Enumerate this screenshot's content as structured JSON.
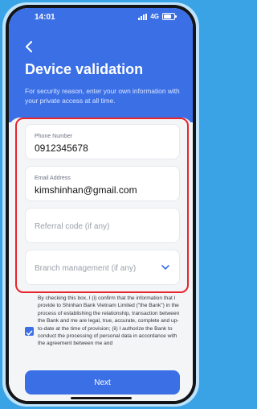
{
  "status": {
    "time": "14:01",
    "network": "4G"
  },
  "header": {
    "title": "Device validation",
    "subtitle": "For security reason, enter your own information with your private access at all time."
  },
  "form": {
    "phone_label": "Phone Number",
    "phone_value": "0912345678",
    "email_label": "Email Address",
    "email_value": "kimshinhan@gmail.com",
    "referral_placeholder": "Referral code (if any)",
    "branch_placeholder": "Branch management (if any)"
  },
  "consent": {
    "checked": true,
    "text": "By checking this box, I (i) confirm that the information that I provide to Shinhan Bank Vietnam Limited (\"the Bank\") in the process of establishing the relationship, transaction between the Bank and me are legal, true, accurate, complete and up-to-date at the time of provision; (ii) I authorize the Bank to conduct the processing of personal data in accordance with the agreement between me and"
  },
  "next_label": "Next",
  "colors": {
    "primary": "#3b6fe6",
    "highlight": "#e8242c",
    "background": "#3aa3e6"
  }
}
